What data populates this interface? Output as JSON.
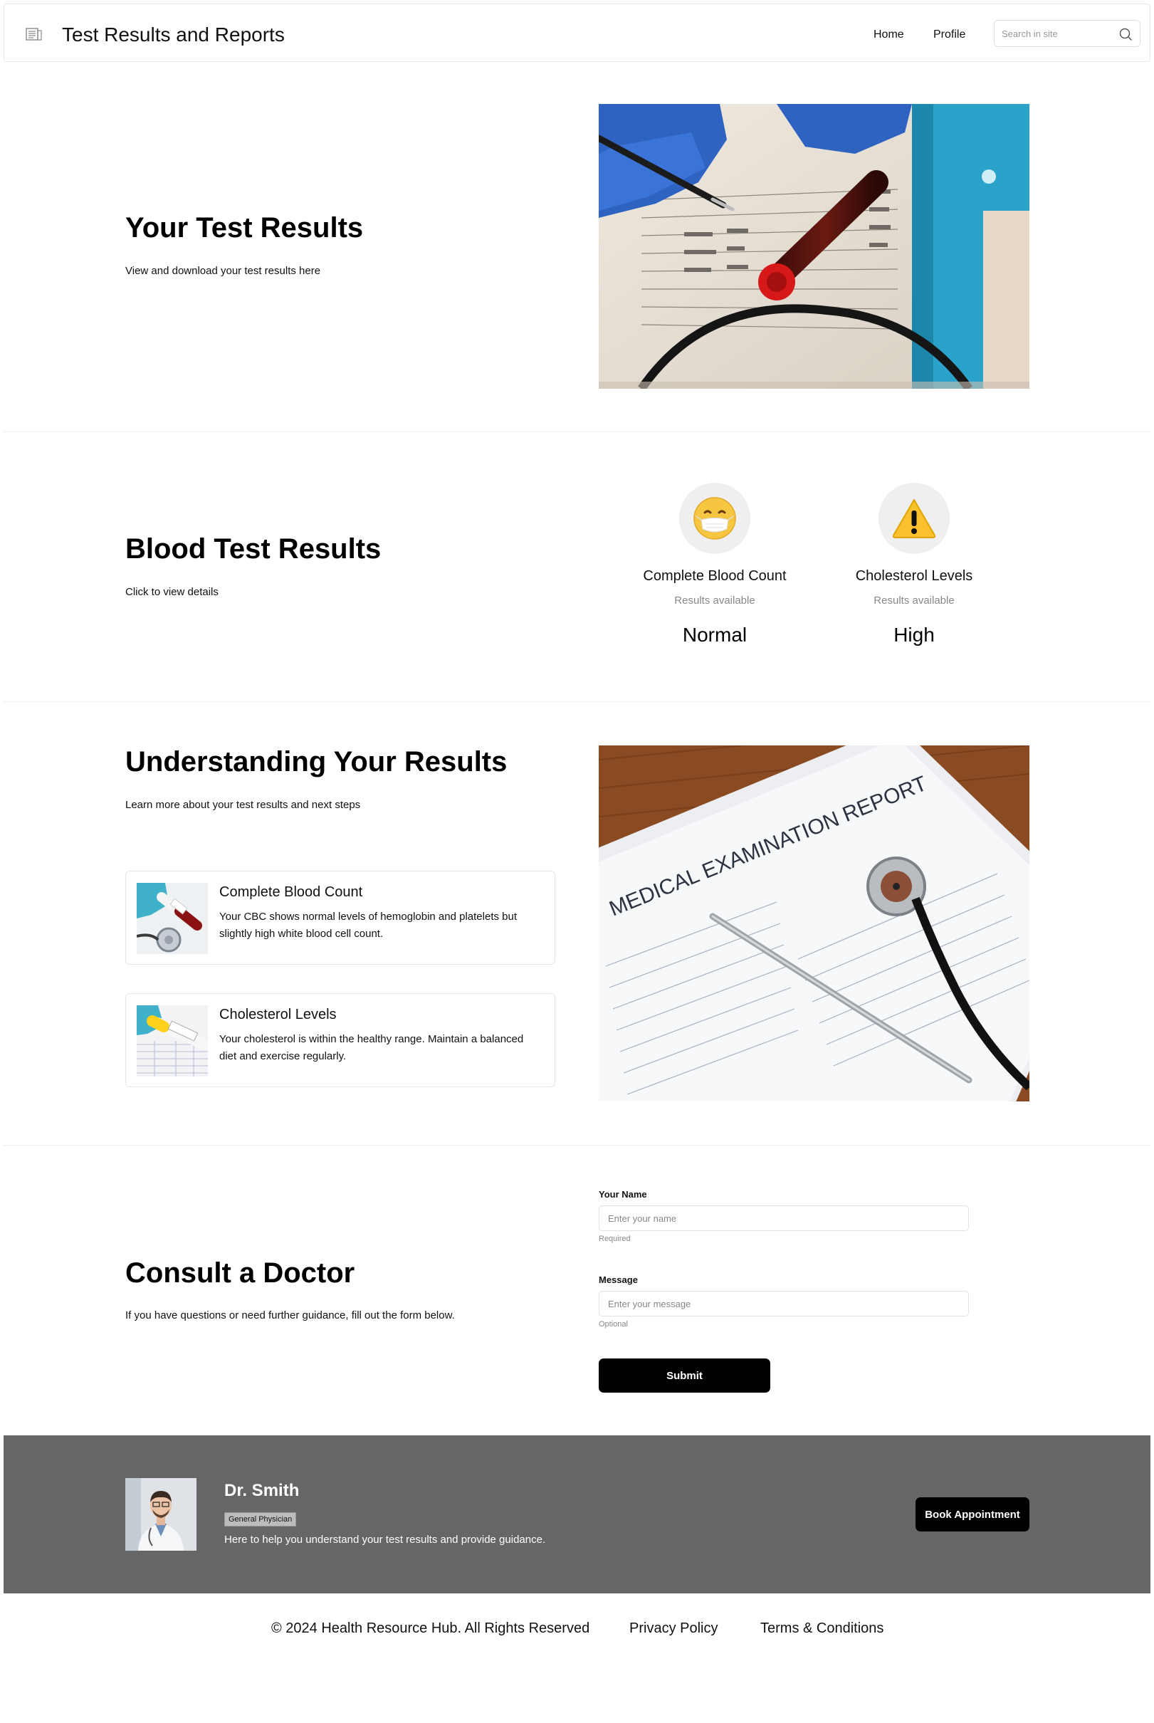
{
  "header": {
    "title": "Test Results and Reports",
    "logo_icon": "report-icon",
    "nav": [
      "Home",
      "Profile"
    ],
    "search_placeholder": "Search in site",
    "search_icon": "search-icon"
  },
  "hero": {
    "title": "Your Test Results",
    "subtitle": "View and download your test results here"
  },
  "blood": {
    "title": "Blood Test Results",
    "subtitle": "Click to view details",
    "items": [
      {
        "icon": "face-with-mask-icon",
        "emoji": "😷",
        "title": "Complete Blood Count",
        "status": "Results available",
        "value": "Normal"
      },
      {
        "icon": "warning-icon",
        "emoji": "⚠️",
        "title": "Cholesterol Levels",
        "status": "Results available",
        "value": "High"
      }
    ]
  },
  "understanding": {
    "title": "Understanding Your Results",
    "subtitle": "Learn more about your test results and next steps",
    "cards": [
      {
        "title": "Complete Blood Count",
        "text": "Your CBC shows normal levels of hemoglobin and platelets but slightly high white blood cell count."
      },
      {
        "title": "Cholesterol Levels",
        "text": "Your cholesterol is within the healthy range. Maintain a balanced diet and exercise regularly."
      }
    ],
    "report_image_text": "MEDICAL EXAMINATION REPORT"
  },
  "consult": {
    "title": "Consult a Doctor",
    "subtitle": "If you have questions or need further guidance, fill out the form below.",
    "name_label": "Your Name",
    "name_placeholder": "Enter your name",
    "name_hint": "Required",
    "message_label": "Message",
    "message_placeholder": "Enter your message",
    "message_hint": "Optional",
    "submit_label": "Submit"
  },
  "doctor": {
    "name": "Dr. Smith",
    "role": "General Physician",
    "text": "Here to help you understand your test results and provide guidance.",
    "book_label": "Book Appointment"
  },
  "footer": {
    "copyright": "© 2024 Health Resource Hub. All Rights Reserved",
    "privacy": "Privacy Policy",
    "terms": "Terms & Conditions"
  }
}
